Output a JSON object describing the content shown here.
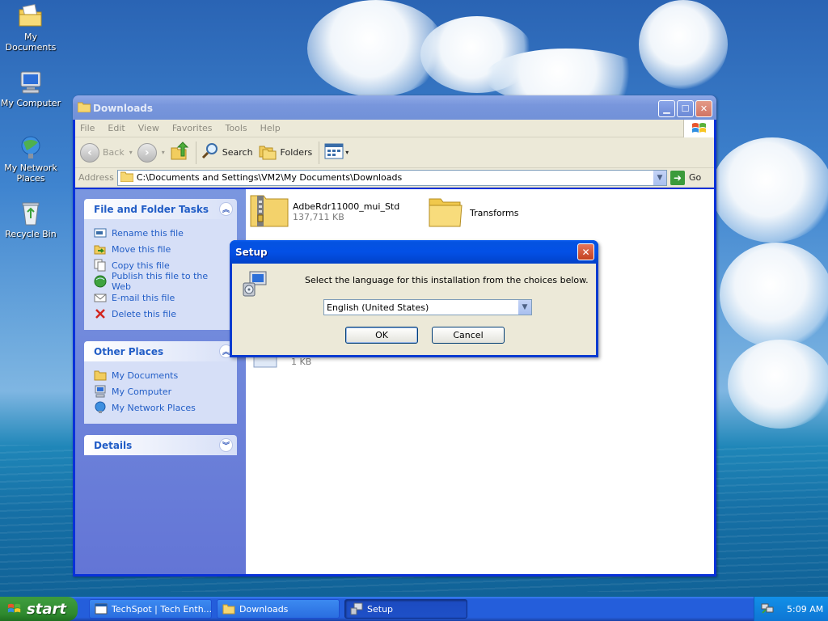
{
  "desktop": {
    "icons": [
      {
        "label": "My Documents",
        "icon": "my-documents-icon"
      },
      {
        "label": "My Computer",
        "icon": "my-computer-icon"
      },
      {
        "label": "My Network Places",
        "icon": "network-places-icon"
      },
      {
        "label": "Recycle Bin",
        "icon": "recycle-bin-icon"
      }
    ]
  },
  "explorer": {
    "title": "Downloads",
    "menu": [
      "File",
      "Edit",
      "View",
      "Favorites",
      "Tools",
      "Help"
    ],
    "toolbar": {
      "back": "Back",
      "search": "Search",
      "folders": "Folders"
    },
    "address": {
      "label": "Address",
      "value": "C:\\Documents and Settings\\VM2\\My Documents\\Downloads",
      "go": "Go"
    },
    "task_panels": {
      "file_tasks": {
        "title": "File and Folder Tasks",
        "items": [
          "Rename this file",
          "Move this file",
          "Copy this file",
          "Publish this file to the Web",
          "E-mail this file",
          "Delete this file"
        ]
      },
      "other_places": {
        "title": "Other Places",
        "items": [
          "My Documents",
          "My Computer",
          "My Network Places"
        ]
      },
      "details": {
        "title": "Details"
      }
    },
    "files": [
      {
        "name": "AdbeRdr11000_mui_Std",
        "size": "137,711 KB",
        "icon": "zip-folder-icon"
      },
      {
        "name": "Transforms",
        "size": "",
        "icon": "folder-icon"
      },
      {
        "name": "",
        "size": "1 KB",
        "icon": "file-icon"
      }
    ]
  },
  "dialog": {
    "title": "Setup",
    "message": "Select the language for this installation from the choices below.",
    "language_selected": "English (United States)",
    "ok": "OK",
    "cancel": "Cancel"
  },
  "taskbar": {
    "start": "start",
    "tasks": [
      {
        "label": "TechSpot | Tech Enth...",
        "active": false
      },
      {
        "label": "Downloads",
        "active": false
      },
      {
        "label": "Setup",
        "active": true
      }
    ],
    "clock": "5:09 AM"
  }
}
